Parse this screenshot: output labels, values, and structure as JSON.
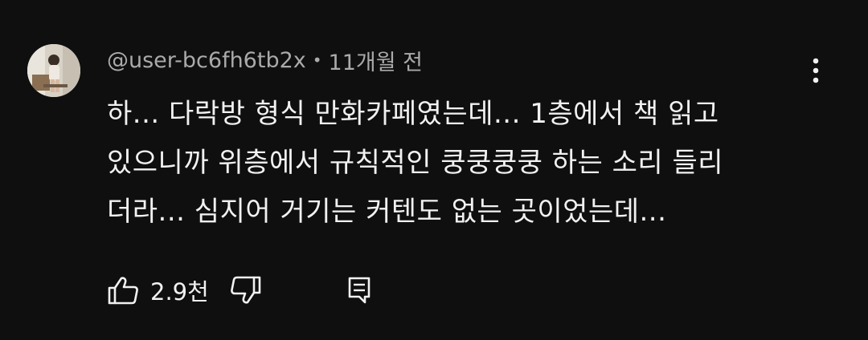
{
  "comment": {
    "author": "@user-bc6fh6tb2x",
    "separator": "•",
    "time": "11개월 전",
    "text_lines": [
      "하... 다락방 형식 만화카페였는데... 1층에서 책 읽고",
      "있으니까 위층에서 규칙적인 쿵쿵쿵쿵 하는 소리 들리",
      "더라... 심지어 거기는 커텐도 없는 곳이었는데..."
    ],
    "like_count": "2.9천"
  },
  "icons": {
    "avatar": "profile-photo",
    "more": "vertical-ellipsis-icon",
    "like": "thumbs-up-icon",
    "dislike": "thumbs-down-icon",
    "reply": "comment-icon"
  },
  "colors": {
    "background": "#0f0f0f",
    "text_primary": "#f1f1f1",
    "text_secondary": "#aaaaaa"
  }
}
